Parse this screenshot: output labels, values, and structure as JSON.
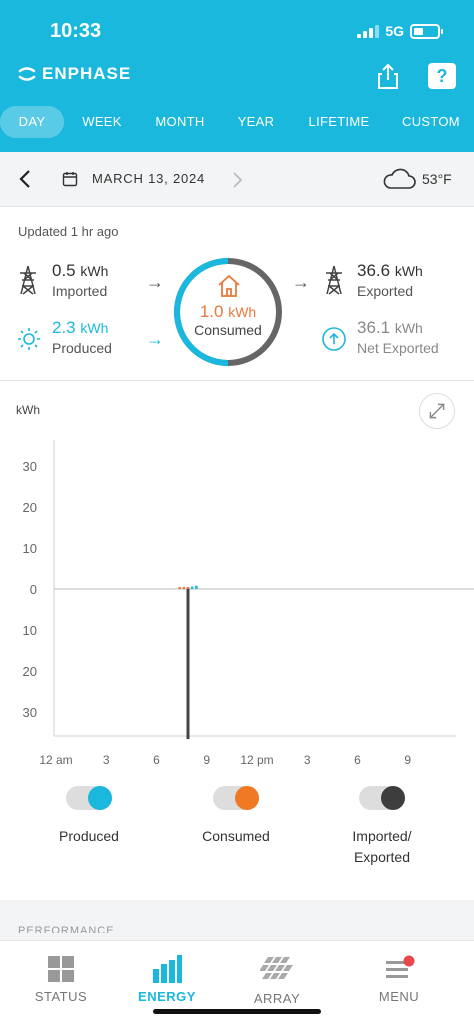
{
  "status_bar": {
    "time": "10:33",
    "network": "5G"
  },
  "header": {
    "brand": "ENPHASE",
    "help_label": "?"
  },
  "tabs": [
    {
      "label": "DAY",
      "active": true
    },
    {
      "label": "WEEK",
      "active": false
    },
    {
      "label": "MONTH",
      "active": false
    },
    {
      "label": "YEAR",
      "active": false
    },
    {
      "label": "LIFETIME",
      "active": false
    },
    {
      "label": "CUSTOM",
      "active": false
    }
  ],
  "date_nav": {
    "date": "MARCH 13, 2024",
    "temperature": "53°F",
    "weather_icon": "cloud-icon"
  },
  "summary": {
    "updated": "Updated 1 hr ago",
    "imported": {
      "value": "0.5",
      "unit": "kWh",
      "label": "Imported"
    },
    "produced": {
      "value": "2.3",
      "unit": "kWh",
      "label": "Produced"
    },
    "consumed": {
      "value": "1.0",
      "unit": "kWh",
      "label": "Consumed"
    },
    "exported": {
      "value": "36.6",
      "unit": "kWh",
      "label": "Exported"
    },
    "net_exported": {
      "value": "36.1",
      "unit": "kWh",
      "label": "Net Exported"
    }
  },
  "chart_data": {
    "type": "bar",
    "ylabel": "kWh",
    "y_ticks_top": [
      "30",
      "20",
      "10",
      "0"
    ],
    "y_ticks_bottom": [
      "10",
      "20",
      "30"
    ],
    "ylim": [
      -35,
      35
    ],
    "x_ticks": [
      "12 am",
      "3",
      "6",
      "9",
      "12 pm",
      "3",
      "6",
      "9"
    ],
    "grid": false,
    "colors": {
      "produced": "#1bb8dd",
      "consumed": "#e8793a",
      "imported_exported": "#444444"
    },
    "series": [
      {
        "name": "Produced",
        "hour": [
          8,
          8.25,
          8.5
        ],
        "values": [
          0.3,
          0.6,
          0.8
        ]
      },
      {
        "name": "Consumed",
        "hour": [
          7.5,
          7.75,
          8
        ],
        "values": [
          0.1,
          0.15,
          0.2
        ]
      },
      {
        "name": "Imported/ Exported",
        "hour": [
          8
        ],
        "values": [
          -36.6
        ]
      }
    ]
  },
  "legend": [
    {
      "label": "Produced",
      "color": "#1bb8dd"
    },
    {
      "label": "Consumed",
      "color": "#f07a24"
    },
    {
      "label": "Imported/ Exported",
      "color": "#3d3d3d"
    }
  ],
  "performance_label": "PERFORMANCE",
  "bottom_nav": [
    {
      "label": "STATUS",
      "icon": "grid-icon",
      "active": false
    },
    {
      "label": "ENERGY",
      "icon": "bar-chart-icon",
      "active": true
    },
    {
      "label": "ARRAY",
      "icon": "solar-panel-icon",
      "active": false
    },
    {
      "label": "MENU",
      "icon": "menu-icon",
      "active": false
    }
  ]
}
